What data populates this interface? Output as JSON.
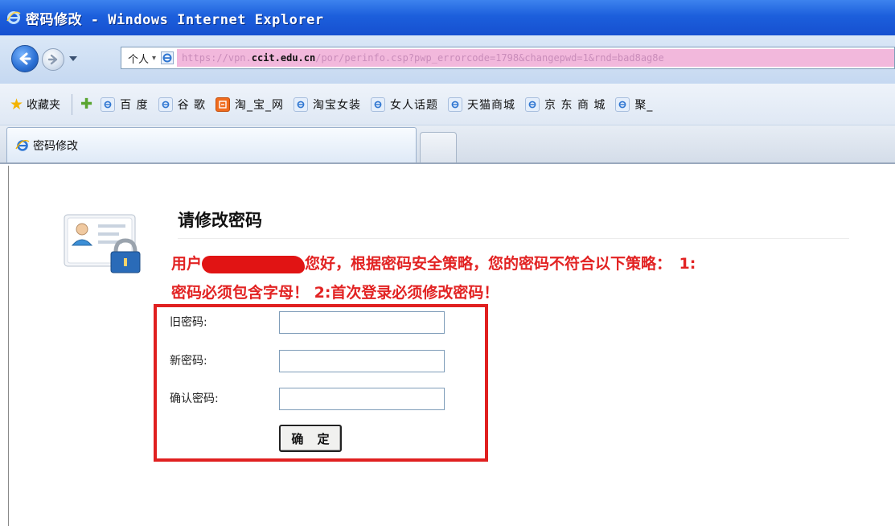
{
  "window": {
    "title": "密码修改 - Windows Internet Explorer"
  },
  "address_bar": {
    "zone_label": "个人",
    "zone_arrow": "▾",
    "url_before_host": "https://vpn.",
    "url_host": "ccit.edu.cn",
    "url_after_host": "/por/perinfo.csp?pwp_errorcode=1798&changepwd=1&rnd=bad8ag8e"
  },
  "favorites_bar": {
    "favorites_label": "收藏夹",
    "items": [
      {
        "label": "百 度",
        "icon": "ie-page-icon"
      },
      {
        "label": "谷 歌",
        "icon": "ie-page-icon"
      },
      {
        "label": "淘_宝_网",
        "icon": "taobao-icon"
      },
      {
        "label": "淘宝女装",
        "icon": "ie-page-icon"
      },
      {
        "label": "女人话题",
        "icon": "ie-page-icon"
      },
      {
        "label": "天猫商城",
        "icon": "ie-page-icon"
      },
      {
        "label": "京 东 商 城",
        "icon": "ie-page-icon"
      },
      {
        "label": "聚_",
        "icon": "ie-page-icon"
      }
    ]
  },
  "tabs": [
    {
      "label": "密码修改",
      "active": true
    }
  ],
  "page": {
    "heading": "请修改密码",
    "notice_prefix": "用户",
    "notice_after_redaction": "您好，根据密码安全策略，您的密码不符合以下策略：　1:",
    "notice_line2": "密码必须包含字母！ 2:首次登录必须修改密码！",
    "form": {
      "old_password_label": "旧密码:",
      "new_password_label": "新密码:",
      "confirm_password_label": "确认密码:",
      "old_password_value": "",
      "new_password_value": "",
      "confirm_password_value": "",
      "submit_label": "确 定"
    }
  },
  "colors": {
    "notice_text": "#e22323",
    "highlight_box": "#e02020",
    "title_bar": "#1c5fdc",
    "url_highlight": "#f2b8dc"
  }
}
